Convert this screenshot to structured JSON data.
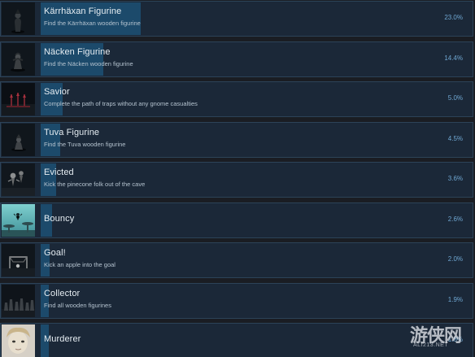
{
  "colors": {
    "row_background": "#1b2838",
    "row_border": "#2c4358",
    "progress_fill": "#1c4a6b",
    "title_text": "#e6edf2",
    "description_text": "#b4c2ce",
    "percent_text": "#6fa7d2"
  },
  "achievements": [
    {
      "title": "Kärrhäxan Figurine",
      "description": "Find the Kärrhäxan wooden figurine",
      "percent_label": "23.0%",
      "percent_value": 23.0,
      "icon": "figurine-witch-icon"
    },
    {
      "title": "Näcken Figurine",
      "description": "Find the Näcken wooden figurine",
      "percent_label": "14.4%",
      "percent_value": 14.4,
      "icon": "figurine-nacken-icon"
    },
    {
      "title": "Savior",
      "description": "Complete the path of traps without any gnome casualties",
      "percent_label": "5.0%",
      "percent_value": 5.0,
      "icon": "traps-scene-icon"
    },
    {
      "title": "Tuva Figurine",
      "description": "Find the Tuva wooden figurine",
      "percent_label": "4.5%",
      "percent_value": 4.5,
      "icon": "figurine-tuva-icon"
    },
    {
      "title": "Evicted",
      "description": "Kick the pinecone folk out of the cave",
      "percent_label": "3.6%",
      "percent_value": 3.6,
      "icon": "pinecone-folk-icon"
    },
    {
      "title": "Bouncy",
      "description": "",
      "percent_label": "2.6%",
      "percent_value": 2.6,
      "icon": "mushroom-bounce-icon"
    },
    {
      "title": "Goal!",
      "description": "Kick an apple into the goal",
      "percent_label": "2.0%",
      "percent_value": 2.0,
      "icon": "apple-goal-icon"
    },
    {
      "title": "Collector",
      "description": "Find all wooden figurines",
      "percent_label": "1.9%",
      "percent_value": 1.9,
      "icon": "figurine-collection-icon"
    },
    {
      "title": "Murderer",
      "description": "",
      "percent_label": "1.8%",
      "percent_value": 1.8,
      "icon": "murderer-face-icon"
    }
  ],
  "watermark": {
    "text": "游侠网",
    "subtext": "ALI213.NET"
  }
}
